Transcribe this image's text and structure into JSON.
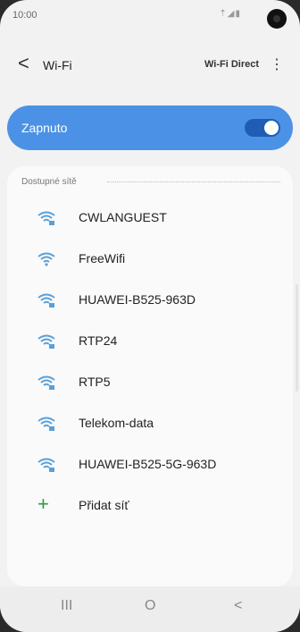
{
  "status": {
    "time": "10:00",
    "indicators": "⇡◢▮"
  },
  "header": {
    "back": "<",
    "title": "Wi-Fi",
    "wifi_direct": "Wi-Fi Direct",
    "more": "⋮"
  },
  "toggle": {
    "label": "Zapnuto",
    "on": true,
    "accent": "#4b92e6"
  },
  "section": {
    "title": "Dostupné sítě"
  },
  "networks": [
    {
      "name": "CWLANGUEST",
      "secured": true,
      "icon": "wifi-lock-icon"
    },
    {
      "name": "FreeWifi",
      "secured": false,
      "icon": "wifi-icon"
    },
    {
      "name": "HUAWEI-B525-963D",
      "secured": true,
      "icon": "wifi-lock-icon"
    },
    {
      "name": "RTP24",
      "secured": true,
      "icon": "wifi-lock-icon"
    },
    {
      "name": "RTP5",
      "secured": true,
      "icon": "wifi-lock-icon"
    },
    {
      "name": "Telekom-data",
      "secured": true,
      "icon": "wifi-lock-icon"
    },
    {
      "name": "HUAWEI-B525-5G-963D",
      "secured": true,
      "icon": "wifi-lock-icon"
    }
  ],
  "add_network": {
    "icon": "+",
    "label": "Přidat síť"
  },
  "navbar": {
    "recent": "III",
    "home": "O",
    "back": "<"
  }
}
